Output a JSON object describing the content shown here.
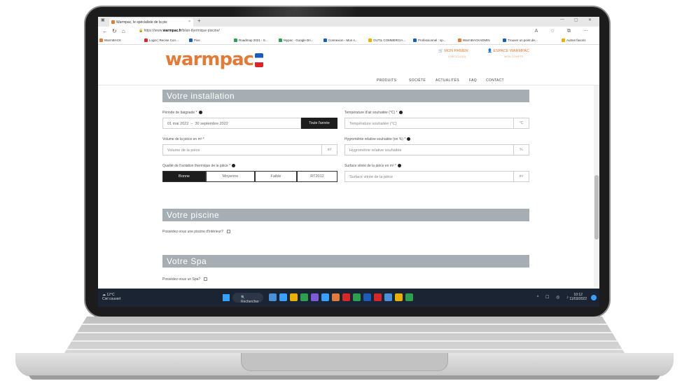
{
  "browser": {
    "tab_title": "Warmpac, le spécialiste de la pis",
    "tab_close": "×",
    "new_tab": "+",
    "url_prefix": "https://www.",
    "url_domain": "warmpac.fr",
    "url_path": "/bilan-thermique-piscine/",
    "min": "—",
    "max": "▢",
    "close": "✕",
    "bookmarks": [
      {
        "label": "WarmBACK",
        "color": "#e07b39"
      },
      {
        "label": "Login | Recise Con...",
        "color": "#d62828"
      },
      {
        "label": "Pixe",
        "color": "#1d5bb8"
      },
      {
        "label": "Roadmap 2021 - S...",
        "color": "#2e9e4f"
      },
      {
        "label": "Mypac - Google Dri...",
        "color": "#2e9e4f"
      },
      {
        "label": "Connexion - Mon s...",
        "color": "#1d5bb8"
      },
      {
        "label": "OUTIL COMMERCIA...",
        "color": "#e8b100"
      },
      {
        "label": "Professionnel : sp...",
        "color": "#1d5bb8"
      },
      {
        "label": "WarmBACKADMIN",
        "color": "#e07b39"
      },
      {
        "label": "Trouver un point de...",
        "color": "#1d5bb8"
      },
      {
        "label": "Autres favoris",
        "color": "#e8b100"
      }
    ]
  },
  "site": {
    "logo_text": "warm",
    "logo_pac": "pac",
    "cart_label": "MON PANIER",
    "cart_sub": "0 ARTICLE(S)",
    "account_label": "ESPACE WARMPAC",
    "account_sub": "MON COMPTE",
    "menu": [
      "PRODUITS",
      "SOCIÉTÉ",
      "ACTUALITÉS",
      "FAQ",
      "CONTACT"
    ]
  },
  "form": {
    "installation_title": "Votre installation",
    "periode_label": "Période de baignade *",
    "periode_from": "01 mai 2022",
    "periode_to": "30 septembre 2022",
    "periode_button": "Toute l'année",
    "temp_label": "Température d'air souhaitée (°C) *",
    "temp_placeholder": "Température souhaitée (°C)",
    "temp_unit": "°C",
    "volume_label": "Volume de la pièce en m³ *",
    "volume_placeholder": "Volume de la pièce",
    "volume_unit": "m³",
    "hygro_label": "Hygrométrie relative souhaitée (en %) *",
    "hygro_placeholder": "Hygrométrie relative souhaitée",
    "hygro_unit": "%",
    "isolation_label": "Qualité de l'isolation thermique de la pièce *",
    "isolation_options": [
      "Bonne",
      "Moyenne",
      "Faible",
      "RT2012"
    ],
    "surface_label": "Surface vitrée de la pièce en m² *",
    "surface_placeholder": "Surface vitrée de la pièce",
    "surface_unit": "m²",
    "piscine_title": "Votre piscine",
    "piscine_question": "Possédez-vous une piscine d'intérieur?",
    "spa_title": "Votre Spa",
    "spa_question": "Possédez-vous un Spa?"
  },
  "taskbar": {
    "weather_temp": "12°C",
    "weather_desc": "Ciel couvert",
    "search_label": "Rechercher",
    "time": "10:12",
    "date": "11/03/2022",
    "apps": [
      "#4a90d9",
      "#3aa0ff",
      "#e8b100",
      "#2e9e4f",
      "#7b5cd6",
      "#3aa0ff",
      "#e07b39",
      "#d62828",
      "#2e9e4f",
      "#1d5bb8",
      "#d62828",
      "#4a90d9",
      "#e8b100",
      "#2e9e4f"
    ]
  }
}
